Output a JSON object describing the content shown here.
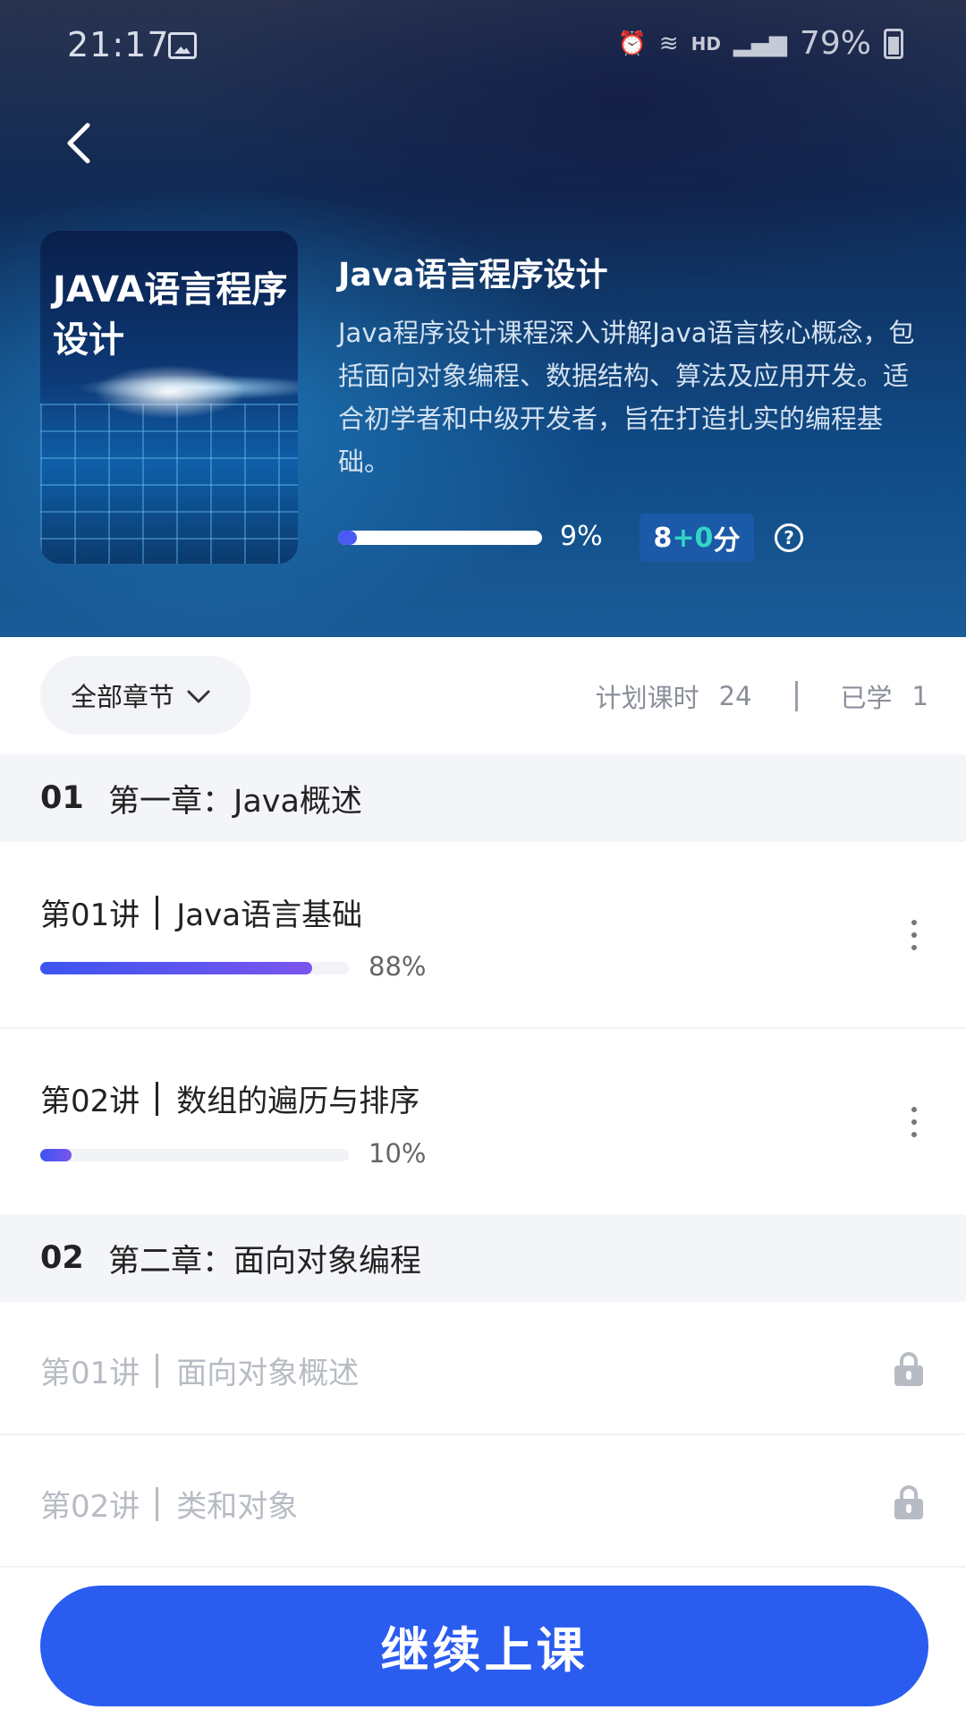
{
  "status_bar": {
    "time": "21:17",
    "network_label": "HD",
    "battery_pct": "79%"
  },
  "course": {
    "cover_text": "JAVA语言程序设计",
    "title": "Java语言程序设计",
    "description": "Java程序设计课程深入讲解Java语言核心概念，包括面向对象编程、数据结构、算法及应用开发。适合初学者和中级开发者，旨在打造扎实的编程基础。",
    "progress": 9,
    "progress_label": "9%",
    "score_base": "8",
    "score_plus": "+0",
    "score_unit": "分",
    "help_symbol": "?"
  },
  "filter": {
    "label": "全部章节",
    "planned_label": "计划课时",
    "planned_value": "24",
    "learned_label": "已学",
    "learned_value": "1"
  },
  "chapters": [
    {
      "number": "01",
      "title": "第一章：Java概述",
      "lessons": [
        {
          "index": "第01讲",
          "title": "Java语言基础",
          "progress": 88,
          "progress_label": "88%",
          "locked": false
        },
        {
          "index": "第02讲",
          "title": "数组的遍历与排序",
          "progress": 10,
          "progress_label": "10%",
          "locked": false
        }
      ]
    },
    {
      "number": "02",
      "title": "第二章：面向对象编程",
      "lessons": [
        {
          "index": "第01讲",
          "title": "面向对象概述",
          "locked": true
        },
        {
          "index": "第02讲",
          "title": "类和对象",
          "locked": true
        }
      ]
    }
  ],
  "cta": {
    "label": "继续上课"
  },
  "colors": {
    "accent": "#2a5cf0",
    "progress_fill": "#4a5bf5",
    "locked_text": "#b7bbc3",
    "score_plus": "#33d6c6"
  },
  "icons": {
    "back": "chevron-left-icon",
    "dropdown": "chevron-down-icon",
    "help": "question-circle-icon",
    "more": "more-vertical-icon",
    "lock": "lock-icon"
  }
}
